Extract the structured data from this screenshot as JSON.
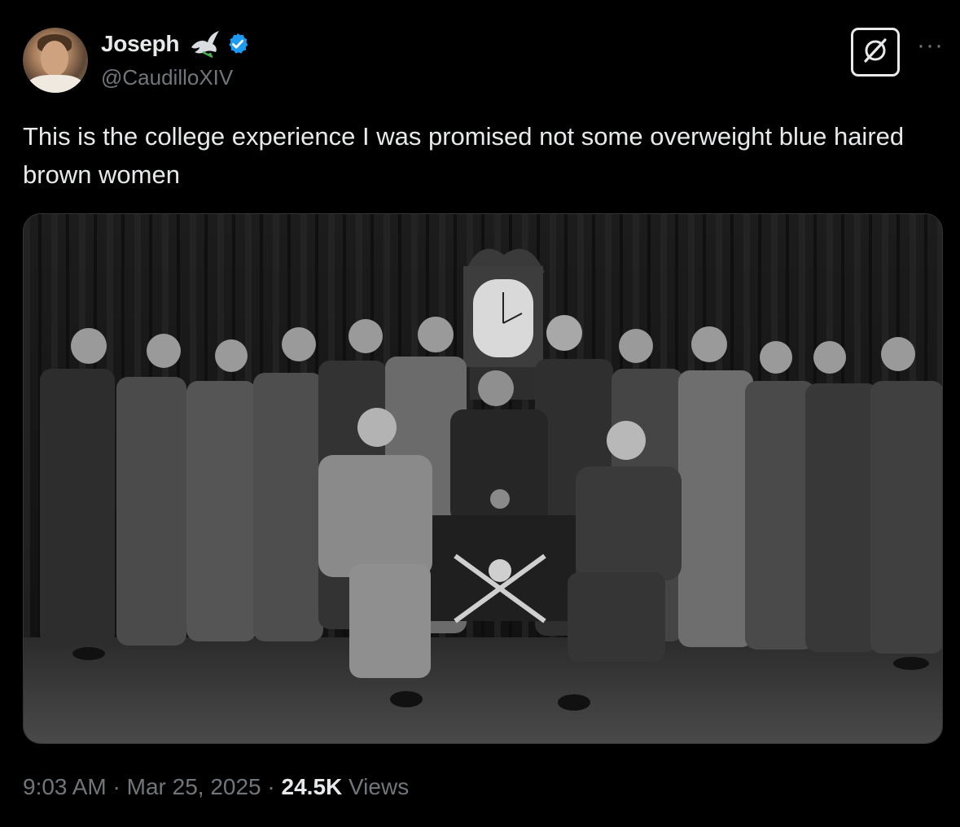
{
  "author": {
    "name": "Joseph",
    "handle": "@CaudilloXIV",
    "badges": [
      "dove-icon",
      "verified-badge-icon"
    ]
  },
  "tweet": {
    "text": "This is the college experience I was promised not some overweight blue haired brown women",
    "media": {
      "type": "photo",
      "description_icon": "group-photo"
    }
  },
  "meta": {
    "time": "9:03 AM",
    "separator": "·",
    "date": "Mar 25, 2025",
    "views_count": "24.5K",
    "views_label": "Views"
  },
  "actions": {
    "grok_icon": "grok-icon",
    "more_icon": "more-icon",
    "more_glyph": "···"
  },
  "colors": {
    "background": "#000000",
    "text": "#e7e9ea",
    "muted": "#71767b",
    "verified": "#1d9bf0"
  }
}
